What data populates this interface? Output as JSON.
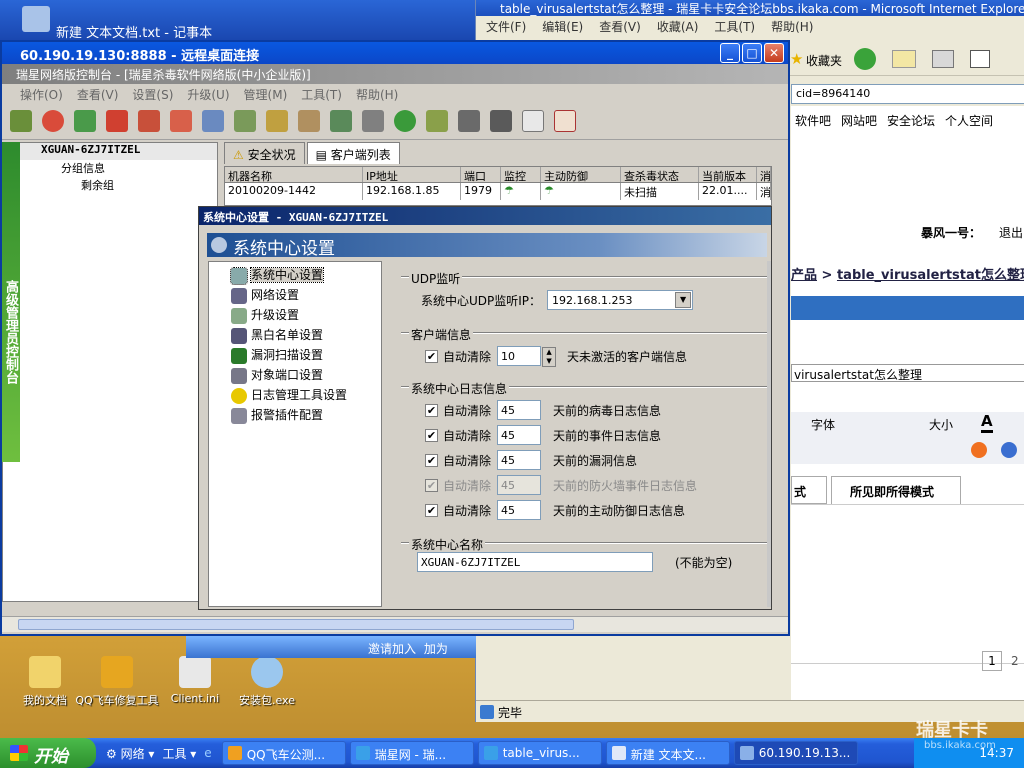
{
  "background_windows": {
    "notepad_title": "新建 文本文档.txt - 记事本"
  },
  "ie": {
    "title": "table_virusalertstat怎么整理 - 瑞星卡卡安全论坛bbs.ikaka.com - Microsoft Internet Explorer",
    "menu": [
      "文件(F)",
      "编辑(E)",
      "查看(V)",
      "收藏(A)",
      "工具(T)",
      "帮助(H)"
    ],
    "favorites": "收藏夹",
    "address": "cid=8964140",
    "nav_links": [
      "软件吧",
      "网站吧",
      "安全论坛",
      "个人空间"
    ],
    "user": "暴风一号：",
    "logout": "退出",
    "breadcrumb_a": "产品",
    "breadcrumb_b": "table_virusalertstat怎么整理",
    "subject": "virusalertstat怎么整理",
    "font_label": "字体",
    "size_label": "大小",
    "mode_tab_a": "式",
    "mode_tab_b": "所见即所得模式",
    "pages": [
      "1",
      "2"
    ],
    "status": "完毕"
  },
  "rdp": {
    "title": "60.190.19.130:8888 - 远程桌面连接",
    "btn_min": "_",
    "btn_max": "□",
    "btn_close": "✕"
  },
  "rising": {
    "title": "瑞星网络版控制台 - [瑞星杀毒软件网络版(中小企业版)]",
    "menu": [
      "操作(O)",
      "查看(V)",
      "设置(S)",
      "升级(U)",
      "管理(M)",
      "工具(T)",
      "帮助(H)"
    ],
    "brand": "高级管理员控制台",
    "tree": {
      "root": "XGUAN-6ZJ7ITZEL",
      "group": "分组信息",
      "subgroup": "剩余组"
    },
    "tabs": [
      "安全状况",
      "客户端列表"
    ],
    "table": {
      "headers": [
        "机器名称",
        "IP地址",
        "端口",
        "监控",
        "主动防御",
        "查杀毒状态",
        "当前版本",
        "消"
      ],
      "row": [
        "20100209-1442",
        "192.168.1.85",
        "1979",
        "",
        "",
        "未扫描",
        "22.01....",
        "消"
      ]
    }
  },
  "dialog": {
    "title": "系统中心设置 - XGUAN-6ZJ7ITZEL",
    "header": "系统中心设置",
    "nav": [
      "系统中心设置",
      "网络设置",
      "升级设置",
      "黑白名单设置",
      "漏洞扫描设置",
      "对象端口设置",
      "日志管理工具设置",
      "报警插件配置"
    ],
    "udp": {
      "group": "UDP监听",
      "label": "系统中心UDP监听IP：",
      "value": "192.168.1.253"
    },
    "client": {
      "group": "客户端信息",
      "check": "自动清除",
      "value": "10",
      "suffix": "天未激活的客户端信息"
    },
    "log": {
      "group": "系统中心日志信息",
      "rows": [
        {
          "check": "自动清除",
          "value": "45",
          "suffix": "天前的病毒日志信息",
          "disabled": false
        },
        {
          "check": "自动清除",
          "value": "45",
          "suffix": "天前的事件日志信息",
          "disabled": false
        },
        {
          "check": "自动清除",
          "value": "45",
          "suffix": "天前的漏洞信息",
          "disabled": false
        },
        {
          "check": "自动清除",
          "value": "45",
          "suffix": "天前的防火墙事件日志信息",
          "disabled": true
        },
        {
          "check": "自动清除",
          "value": "45",
          "suffix": "天前的主动防御日志信息",
          "disabled": false
        }
      ]
    },
    "name": {
      "group": "系统中心名称",
      "value": "XGUAN-6ZJ7ITZEL",
      "hint": "(不能为空)"
    }
  },
  "desktop": {
    "icons": [
      "我的文档",
      "QQ飞车修复工具",
      "Client.ini",
      "安装包.exe"
    ],
    "popup_invite": "邀请加入",
    "popup_add": "加为"
  },
  "taskbar": {
    "start": "开始",
    "quick": [
      "网络",
      "工具"
    ],
    "tasks": [
      "QQ飞车公测...",
      "瑞星网 - 瑞...",
      "table_virus...",
      "新建 文本文...",
      "60.190.19.13..."
    ],
    "time": "14:37",
    "watermark": "瑞星卡卡",
    "watermark_url": "bbs.ikaka.com"
  },
  "colors": {
    "xp_blue": "#245edb",
    "dialog_title": "#0a246a",
    "rising_green": "#2d8b2d"
  }
}
